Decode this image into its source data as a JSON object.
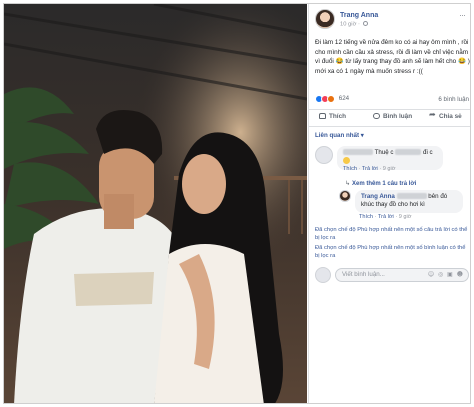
{
  "post": {
    "author": "Trang Anna",
    "time": "10 giờ",
    "text": "Đi làm 12 tiếng về nửa đêm ko có ai hay ôm mình , rồi cho mình cần cầu xả stress, rồi đi làm về chỉ việc nằm vì đuổi 😂 từ lấy trang thay đồ anh sẽ làm hết cho 😂 ) mới xa có 1 ngày mà muốn stress r :(("
  },
  "reactions": {
    "count": "624",
    "comments": "6 bình luận",
    "colors": {
      "like": "#1877f2",
      "love": "#f33e58",
      "angry": "#e9710f"
    }
  },
  "actions": {
    "like": "Thích",
    "comment": "Bình luận",
    "share": "Chia sẻ"
  },
  "sort_label": "Liên quan nhất ▾",
  "comments": [
    {
      "text": "Thuệ c",
      "text2": "đi c",
      "meta_like": "Thích",
      "meta_reply": "Trả lời",
      "meta_time": "9 giờ",
      "view_replies": "Xem thêm 1 câu trả lời"
    }
  ],
  "reply": {
    "author": "Trang Anna",
    "text": "bên đó khúc thay đồ cho hơi kì",
    "meta_like": "Thích",
    "meta_reply": "Trả lời",
    "meta_time": "9 giờ"
  },
  "filtered_1": "Đã chọn chế độ Phù hợp nhất nên một số câu trả lời có thể bị lọc ra",
  "filtered_2": "Đã chọn chế độ Phù hợp nhất nên một số bình luận có thể bị lọc ra",
  "write_placeholder": "Viết bình luận...",
  "write_icons": "☺ ◎ ▣ ☻"
}
